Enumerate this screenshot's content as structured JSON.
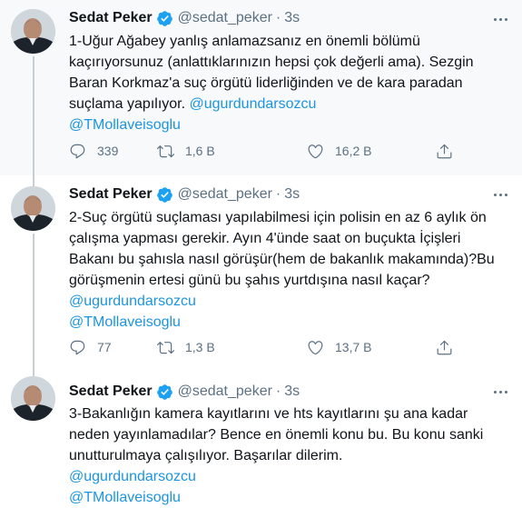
{
  "author": {
    "name": "Sedat Peker",
    "handle": "@sedat_peker",
    "separator": "·"
  },
  "tweets": [
    {
      "time": "3s",
      "lines": [
        {
          "text": "1-Uğur Ağabey yanlış anlamazsanız en önemli bölümü"
        },
        {
          "text": "kaçırıyorsunuz (anlattıklarınızın hepsi çok değerli ama). Sezgin"
        },
        {
          "text": "Baran Korkmaz'a suç örgütü liderliğinden ve de kara paradan"
        },
        {
          "text": "suçlama yapılıyor. ",
          "mention": "@ugurdundarsozcu"
        },
        {
          "mention": "@TMollaveisoglu"
        }
      ],
      "replies": "339",
      "retweets": "1,6 B",
      "likes": "16,2 B"
    },
    {
      "time": "3s",
      "lines": [
        {
          "text": "2-Suç örgütü suçlaması yapılabilmesi için polisin en az 6 aylık ön"
        },
        {
          "text": "çalışma yapması gerekir. Ayın 4'ünde saat on buçukta İçişleri"
        },
        {
          "text": "Bakanı bu şahısla nasıl görüşür(hem de bakanlık makamında)?Bu"
        },
        {
          "text": "görüşmenin ertesi günü bu şahıs yurtdışına nasıl kaçar?"
        },
        {
          "mention": "@ugurdundarsozcu"
        },
        {
          "mention": "@TMollaveisoglu"
        }
      ],
      "replies": "77",
      "retweets": "1,3 B",
      "likes": "13,7 B"
    },
    {
      "time": "3s",
      "lines": [
        {
          "text": "3-Bakanlığın kamera kayıtlarını ve hts kayıtlarını şu ana kadar"
        },
        {
          "text": "neden yayınlamadılar? Bence en önemli konu bu. Bu konu sanki"
        },
        {
          "text": "unutturulmaya çalışılıyor. Başarılar dilerim."
        },
        {
          "mention": "@ugurdundarsozcu"
        },
        {
          "mention": "@TMollaveisoglu"
        }
      ]
    }
  ],
  "colors": {
    "mention": "#1b95e0",
    "muted": "#5b7083",
    "verified": "#1da1f2",
    "highlight_bg": "#f7f9fa",
    "thread_line": "#c4cfd6"
  },
  "icons": [
    "verified-badge-icon",
    "more-icon",
    "reply-icon",
    "retweet-icon",
    "like-icon",
    "share-icon"
  ]
}
